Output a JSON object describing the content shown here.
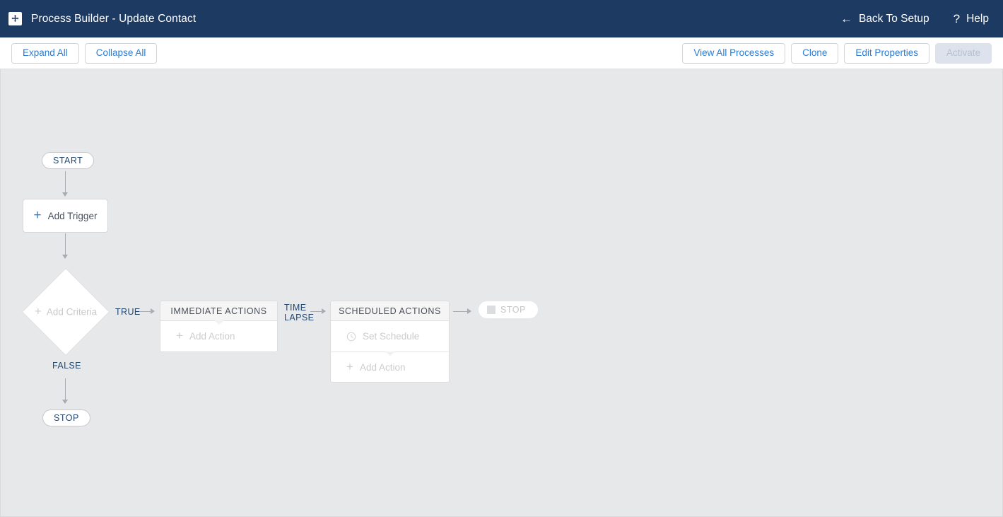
{
  "header": {
    "app_icon": "process-builder-icon",
    "title": "Process Builder - Update Contact",
    "back_label": "Back To Setup",
    "back_icon": "arrow-left-icon",
    "help_label": "Help",
    "help_icon": "question-mark-icon",
    "background_color": "#1d3a63"
  },
  "toolbar": {
    "expand_all": "Expand All",
    "collapse_all": "Collapse All",
    "view_all_processes": "View All Processes",
    "clone": "Clone",
    "edit_properties": "Edit Properties",
    "activate": "Activate",
    "link_color": "#2a7cd4",
    "disabled_color": "#b6bfd0"
  },
  "canvas": {
    "background_color": "#e7e8ea",
    "start_node": "START",
    "stop_node": "STOP",
    "add_trigger": {
      "label": "Add Trigger",
      "icon": "plus-icon"
    },
    "criteria": {
      "label": "Add Criteria",
      "icon": "plus-icon",
      "true_label": "TRUE",
      "false_label": "FALSE"
    },
    "time_lapse": {
      "line1": "TIME",
      "line2": "LAPSE"
    },
    "immediate_actions": {
      "title": "IMMEDIATE ACTIONS",
      "add_action": "Add Action",
      "add_action_icon": "plus-icon"
    },
    "scheduled_actions": {
      "title": "SCHEDULED ACTIONS",
      "set_schedule": "Set Schedule",
      "set_schedule_icon": "clock-icon",
      "add_action": "Add Action",
      "add_action_icon": "plus-icon"
    },
    "end_stop": {
      "label": "STOP",
      "icon": "stop-square-icon"
    }
  }
}
